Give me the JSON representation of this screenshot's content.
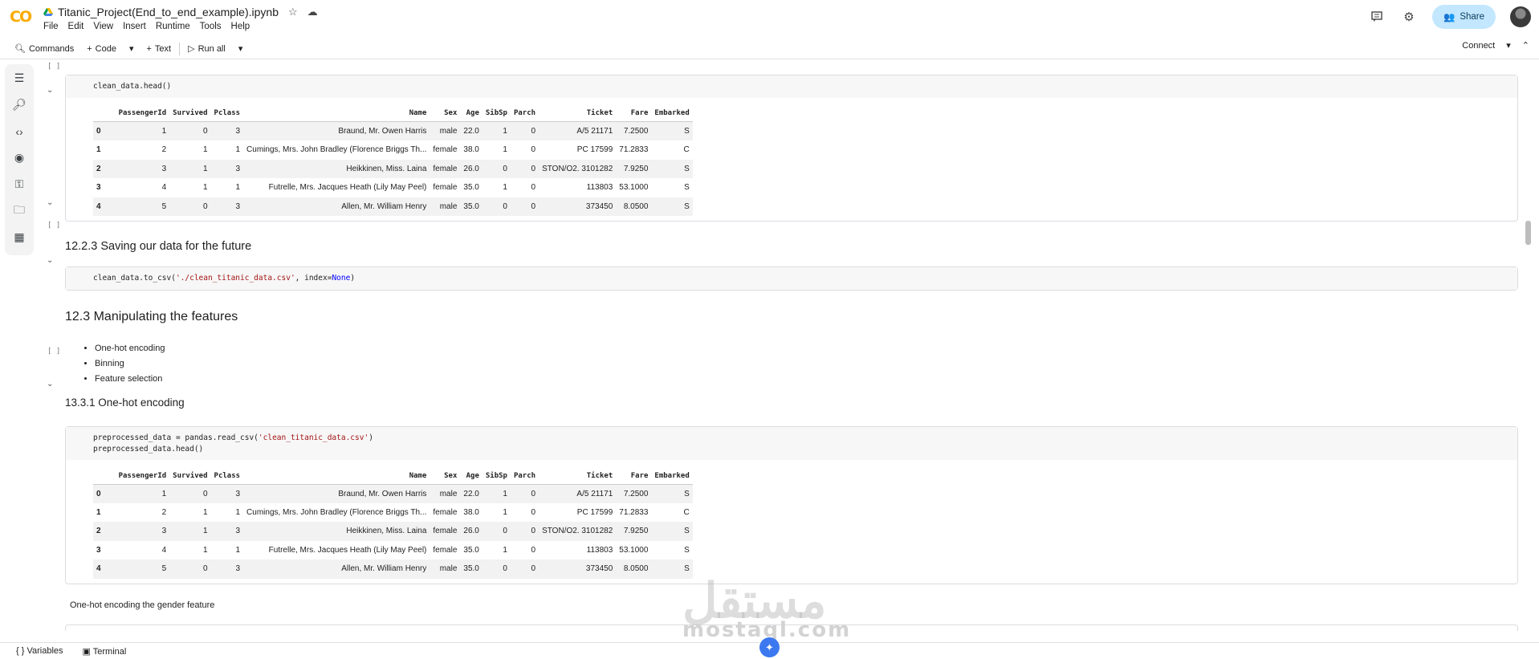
{
  "app": {
    "logo": "CO",
    "title": "Titanic_Project(End_to_end_example).ipynb",
    "menu": [
      "File",
      "Edit",
      "View",
      "Insert",
      "Runtime",
      "Tools",
      "Help"
    ],
    "share_label": "Share"
  },
  "toolbar": {
    "commands": "Commands",
    "code": "Code",
    "text": "Text",
    "run_all": "Run all",
    "connect": "Connect"
  },
  "cells": {
    "cell1": {
      "marker": "[ ]",
      "code": "clean_data.head()"
    },
    "heading1": "12.2.3 Saving our data for the future",
    "cell2": {
      "marker": "[ ]",
      "code_prefix": "clean_data.to_csv(",
      "code_str": "'./clean_titanic_data.csv'",
      "code_mid": ", index=",
      "code_kw": "None",
      "code_suffix": ")"
    },
    "heading2": "12.3 Manipulating the features",
    "bullets": [
      "One-hot encoding",
      "Binning",
      "Feature selection"
    ],
    "heading3": "13.3.1 One-hot encoding",
    "cell3": {
      "marker": "[ ]",
      "line1_prefix": "preprocessed_data = pandas.read_csv(",
      "line1_str": "'clean_titanic_data.csv'",
      "line1_suffix": ")",
      "line2": "preprocessed_data.head()"
    },
    "para1": "One-hot encoding the gender feature"
  },
  "table": {
    "columns": [
      "",
      "PassengerId",
      "Survived",
      "Pclass",
      "Name",
      "Sex",
      "Age",
      "SibSp",
      "Parch",
      "Ticket",
      "Fare",
      "Embarked"
    ],
    "rows": [
      [
        "0",
        "1",
        "0",
        "3",
        "Braund, Mr. Owen Harris",
        "male",
        "22.0",
        "1",
        "0",
        "A/5 21171",
        "7.2500",
        "S"
      ],
      [
        "1",
        "2",
        "1",
        "1",
        "Cumings, Mrs. John Bradley (Florence Briggs Th...",
        "female",
        "38.0",
        "1",
        "0",
        "PC 17599",
        "71.2833",
        "C"
      ],
      [
        "2",
        "3",
        "1",
        "3",
        "Heikkinen, Miss. Laina",
        "female",
        "26.0",
        "0",
        "0",
        "STON/O2. 3101282",
        "7.9250",
        "S"
      ],
      [
        "3",
        "4",
        "1",
        "1",
        "Futrelle, Mrs. Jacques Heath (Lily May Peel)",
        "female",
        "35.0",
        "1",
        "0",
        "113803",
        "53.1000",
        "S"
      ],
      [
        "4",
        "5",
        "0",
        "3",
        "Allen, Mr. William Henry",
        "male",
        "35.0",
        "0",
        "0",
        "373450",
        "8.0500",
        "S"
      ]
    ]
  },
  "statusbar": {
    "variables": "Variables",
    "terminal": "Terminal"
  },
  "watermark": {
    "latin": "mostaql.com",
    "arabic": "مستقل"
  },
  "colors": {
    "accent": "#c2e7ff",
    "logo_orange": "#f9ab00",
    "gemini_blue": "#3c78f0"
  }
}
